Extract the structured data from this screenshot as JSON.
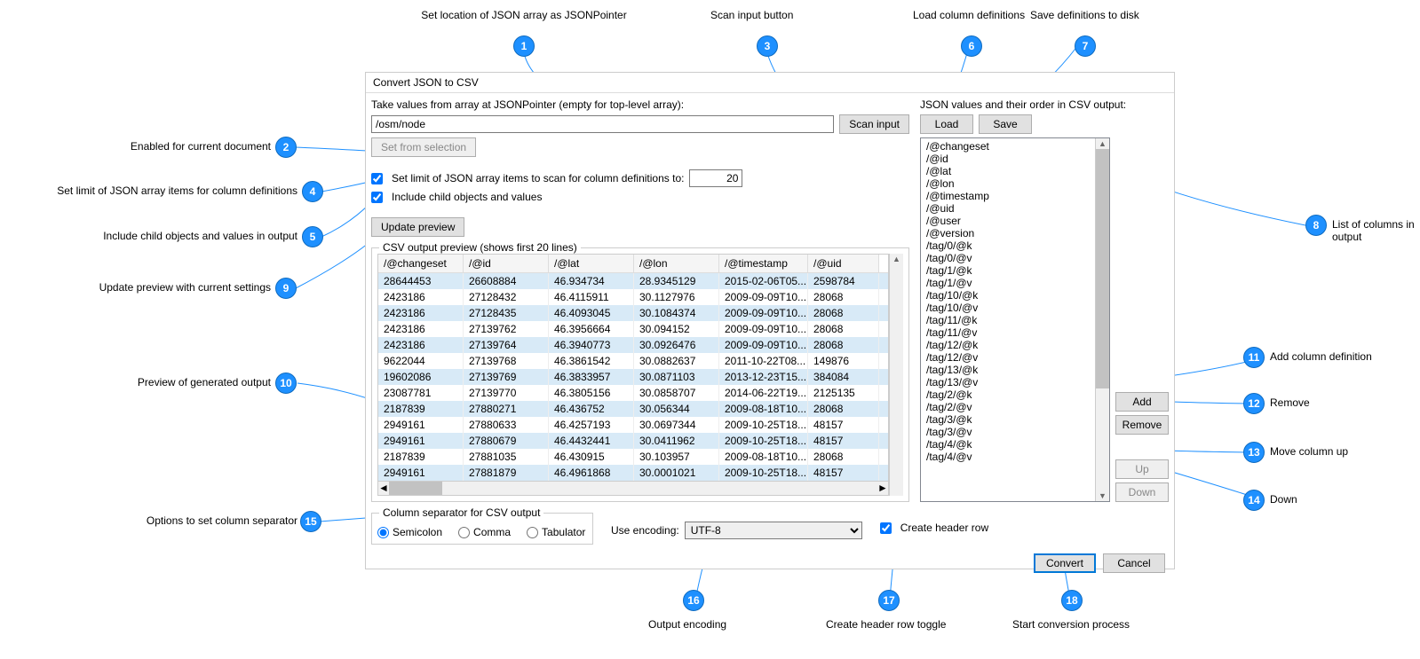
{
  "window_title": "Convert JSON to CSV",
  "pointer_label": "Take values from array at JSONPointer (empty for top-level array):",
  "pointer_value": "/osm/node",
  "scan_btn": "Scan input",
  "set_from_sel": "Set from selection",
  "limit_check": "Set limit of JSON array items to scan for column definitions to:",
  "limit_value": "20",
  "include_children": "Include child objects and values",
  "update_preview": "Update preview",
  "preview_group": "CSV output preview (shows first 20 lines)",
  "columns_label": "JSON values and their order in CSV output:",
  "load": "Load",
  "save": "Save",
  "add": "Add",
  "remove": "Remove",
  "up": "Up",
  "down": "Down",
  "sep_group": "Column separator for CSV output",
  "sep_semi": "Semicolon",
  "sep_comma": "Comma",
  "sep_tab": "Tabulator",
  "use_enc": "Use encoding:",
  "encoding": "UTF-8",
  "create_header": "Create header row",
  "convert": "Convert",
  "cancel": "Cancel",
  "headers": [
    "/@changeset",
    "/@id",
    "/@lat",
    "/@lon",
    "/@timestamp",
    "/@uid"
  ],
  "rows": [
    [
      "28644453",
      "26608884",
      "46.934734",
      "28.9345129",
      "2015-02-06T05...",
      "2598784"
    ],
    [
      "2423186",
      "27128432",
      "46.4115911",
      "30.1127976",
      "2009-09-09T10...",
      "28068"
    ],
    [
      "2423186",
      "27128435",
      "46.4093045",
      "30.1084374",
      "2009-09-09T10...",
      "28068"
    ],
    [
      "2423186",
      "27139762",
      "46.3956664",
      "30.094152",
      "2009-09-09T10...",
      "28068"
    ],
    [
      "2423186",
      "27139764",
      "46.3940773",
      "30.0926476",
      "2009-09-09T10...",
      "28068"
    ],
    [
      "9622044",
      "27139768",
      "46.3861542",
      "30.0882637",
      "2011-10-22T08...",
      "149876"
    ],
    [
      "19602086",
      "27139769",
      "46.3833957",
      "30.0871103",
      "2013-12-23T15...",
      "384084"
    ],
    [
      "23087781",
      "27139770",
      "46.3805156",
      "30.0858707",
      "2014-06-22T19...",
      "2125135"
    ],
    [
      "2187839",
      "27880271",
      "46.436752",
      "30.056344",
      "2009-08-18T10...",
      "28068"
    ],
    [
      "2949161",
      "27880633",
      "46.4257193",
      "30.0697344",
      "2009-10-25T18...",
      "48157"
    ],
    [
      "2949161",
      "27880679",
      "46.4432441",
      "30.0411962",
      "2009-10-25T18...",
      "48157"
    ],
    [
      "2187839",
      "27881035",
      "46.430915",
      "30.103957",
      "2009-08-18T10...",
      "28068"
    ],
    [
      "2949161",
      "27881879",
      "46.4961868",
      "30.0001021",
      "2009-10-25T18...",
      "48157"
    ]
  ],
  "list": [
    "/@changeset",
    "/@id",
    "/@lat",
    "/@lon",
    "/@timestamp",
    "/@uid",
    "/@user",
    "/@version",
    "/tag/0/@k",
    "/tag/0/@v",
    "/tag/1/@k",
    "/tag/1/@v",
    "/tag/10/@k",
    "/tag/10/@v",
    "/tag/11/@k",
    "/tag/11/@v",
    "/tag/12/@k",
    "/tag/12/@v",
    "/tag/13/@k",
    "/tag/13/@v",
    "/tag/2/@k",
    "/tag/2/@v",
    "/tag/3/@k",
    "/tag/3/@v",
    "/tag/4/@k",
    "/tag/4/@v"
  ],
  "callouts": {
    "1": "Set location of JSON array as JSONPointer",
    "2": "Enabled for current document",
    "3": "Scan input button",
    "4": "Set limit of JSON array items for column definitions",
    "5": "Include child objects and values in output",
    "6": "Load column definitions",
    "7": "Save definitions to disk",
    "8": "List of columns in output",
    "9": "Update preview with current settings",
    "10": "Preview of generated output",
    "11": "Add column definition",
    "12": "Remove",
    "13": "Move column up",
    "14": "Down",
    "15": "Options to set column separator",
    "16": "Output encoding",
    "17": "Create header row toggle",
    "18": "Start conversion process"
  }
}
